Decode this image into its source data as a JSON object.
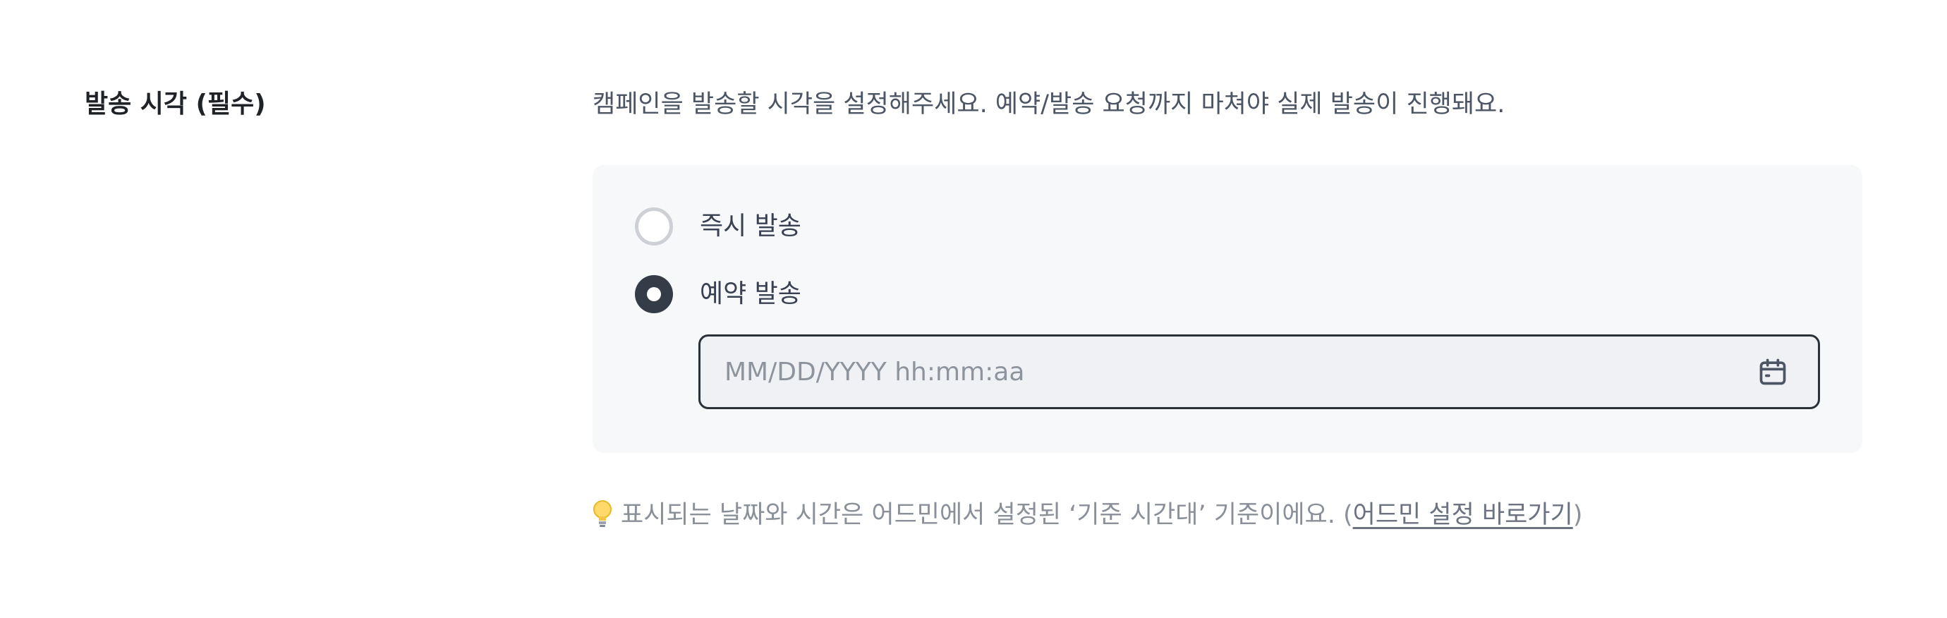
{
  "section": {
    "title": "발송 시각 (필수)",
    "description": "캠페인을 발송할 시각을 설정해주세요. 예약/발송 요청까지 마쳐야 실제 발송이 진행돼요."
  },
  "send_options": [
    {
      "label": "즉시 발송",
      "checked": false
    },
    {
      "label": "예약 발송",
      "checked": true
    }
  ],
  "datetime_input": {
    "value": "",
    "placeholder": "MM/DD/YYYY hh:mm:aa",
    "icon": "calendar-icon"
  },
  "hint": {
    "icon": "lightbulb-icon",
    "text": "표시되는 날짜와 시간은 어드민에서 설정된 ‘기준 시간대’ 기준이에요. (",
    "link_label": "어드민 설정 바로가기",
    "text_end": ")"
  }
}
